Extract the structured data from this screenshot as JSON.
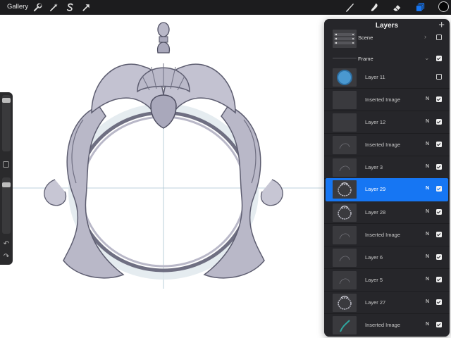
{
  "app": {
    "gallery_label": "Gallery",
    "accent_color": "#1676f3"
  },
  "toolbar": {
    "left_tools": [
      {
        "name": "wrench-icon",
        "tool": "actions"
      },
      {
        "name": "magic-wand-icon",
        "tool": "adjustments"
      },
      {
        "name": "selection-s-icon",
        "tool": "selection"
      },
      {
        "name": "transform-arrow-icon",
        "tool": "transform"
      }
    ],
    "right_tools": [
      {
        "name": "brush-icon",
        "tool": "paint"
      },
      {
        "name": "smudge-icon",
        "tool": "smudge"
      },
      {
        "name": "eraser-icon",
        "tool": "erase"
      },
      {
        "name": "layers-icon",
        "tool": "layers",
        "active": true
      }
    ],
    "current_color": "#060606"
  },
  "layers_panel": {
    "title": "Layers",
    "add_label": "+",
    "groups": [
      {
        "name": "Scene",
        "collapsed": true,
        "visible": false
      },
      {
        "name": "Frame",
        "collapsed": false,
        "visible": true
      }
    ],
    "layers": [
      {
        "name": "Layer 11",
        "blend": "",
        "visible": false,
        "selected": false,
        "thumb": "blue-circle"
      },
      {
        "name": "Inserted Image",
        "blend": "N",
        "visible": true,
        "selected": false,
        "thumb": "blank"
      },
      {
        "name": "Layer 12",
        "blend": "N",
        "visible": true,
        "selected": false,
        "thumb": "blank"
      },
      {
        "name": "Inserted Image",
        "blend": "N",
        "visible": true,
        "selected": false,
        "thumb": "sketch"
      },
      {
        "name": "Layer 3",
        "blend": "N",
        "visible": true,
        "selected": false,
        "thumb": "sketch"
      },
      {
        "name": "Layer 29",
        "blend": "N",
        "visible": true,
        "selected": true,
        "thumb": "frame"
      },
      {
        "name": "Layer 28",
        "blend": "N",
        "visible": true,
        "selected": false,
        "thumb": "frame"
      },
      {
        "name": "Inserted Image",
        "blend": "N",
        "visible": true,
        "selected": false,
        "thumb": "sketch"
      },
      {
        "name": "Layer 6",
        "blend": "N",
        "visible": true,
        "selected": false,
        "thumb": "sketch"
      },
      {
        "name": "Layer 5",
        "blend": "N",
        "visible": true,
        "selected": false,
        "thumb": "sketch"
      },
      {
        "name": "Layer 27",
        "blend": "N",
        "visible": true,
        "selected": false,
        "thumb": "frame"
      },
      {
        "name": "Inserted Image",
        "blend": "N",
        "visible": true,
        "selected": false,
        "thumb": "teal"
      }
    ]
  },
  "sidebar": {
    "brush_size_level": 0.95,
    "opacity_level": 0.9,
    "undo_label": "↶",
    "redo_label": "↷"
  },
  "canvas": {
    "stroke_color": "#6f6f82",
    "fill_color": "#b9b8c8",
    "guide_color": "#a9c3d1"
  }
}
